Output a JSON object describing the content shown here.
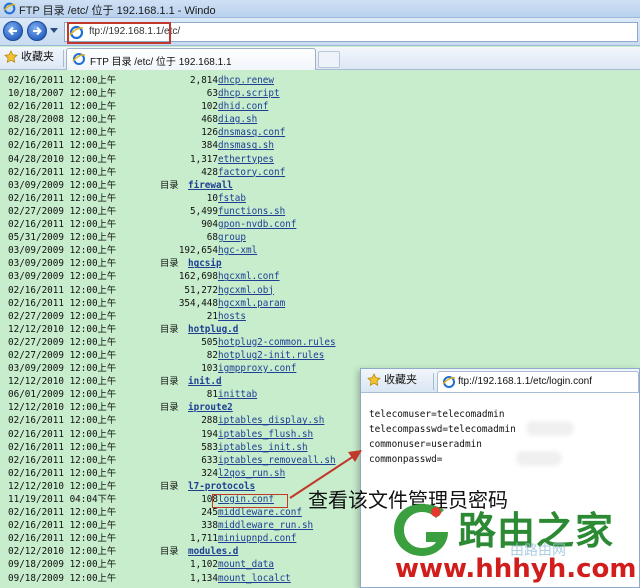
{
  "window": {
    "title": "FTP 目录 /etc/ 位于 192.168.1.1 - Windo"
  },
  "address_bar": {
    "url_host": "ftp://192.168.1.1",
    "url_path": "/etc/"
  },
  "favorites": {
    "label": "收藏夹"
  },
  "tab": {
    "label": "FTP 目录 /etc/ 位于 192.168.1.1"
  },
  "listing": [
    {
      "date": "02/16/2011 12:00上午",
      "size": "2,814",
      "name": "dhcp.renew"
    },
    {
      "date": "10/18/2007 12:00上午",
      "size": "63",
      "name": "dhcp.script"
    },
    {
      "date": "02/16/2011 12:00上午",
      "size": "102",
      "name": "dhid.conf"
    },
    {
      "date": "08/28/2008 12:00上午",
      "size": "468",
      "name": "diag.sh"
    },
    {
      "date": "02/16/2011 12:00上午",
      "size": "126",
      "name": "dnsmasq.conf"
    },
    {
      "date": "02/16/2011 12:00上午",
      "size": "384",
      "name": "dnsmasq.sh"
    },
    {
      "date": "04/28/2010 12:00上午",
      "size": "1,317",
      "name": "ethertypes"
    },
    {
      "date": "02/16/2011 12:00上午",
      "size": "428",
      "name": "factory.conf"
    },
    {
      "date": "03/09/2009 12:00上午",
      "dir": "目录",
      "name": "firewall"
    },
    {
      "date": "02/16/2011 12:00上午",
      "size": "10",
      "name": "fstab"
    },
    {
      "date": "02/27/2009 12:00上午",
      "size": "5,499",
      "name": "functions.sh"
    },
    {
      "date": "02/16/2011 12:00上午",
      "size": "904",
      "name": "gpon-nvdb.conf"
    },
    {
      "date": "05/31/2009 12:00上午",
      "size": "68",
      "name": "group"
    },
    {
      "date": "03/09/2009 12:00上午",
      "size": "192,654",
      "name": "hgc-xml"
    },
    {
      "date": "03/09/2009 12:00上午",
      "dir": "目录",
      "name": "hgcsip"
    },
    {
      "date": "03/09/2009 12:00上午",
      "size": "162,698",
      "name": "hgcxml.conf"
    },
    {
      "date": "02/16/2011 12:00上午",
      "size": "51,272",
      "name": "hgcxml.obj"
    },
    {
      "date": "02/16/2011 12:00上午",
      "size": "354,448",
      "name": "hgcxml.param"
    },
    {
      "date": "02/27/2009 12:00上午",
      "size": "21",
      "name": "hosts"
    },
    {
      "date": "12/12/2010 12:00上午",
      "dir": "目录",
      "name": "hotplug.d"
    },
    {
      "date": "02/27/2009 12:00上午",
      "size": "505",
      "name": "hotplug2-common.rules"
    },
    {
      "date": "02/27/2009 12:00上午",
      "size": "82",
      "name": "hotplug2-init.rules"
    },
    {
      "date": "03/09/2009 12:00上午",
      "size": "103",
      "name": "igmpproxy.conf"
    },
    {
      "date": "12/12/2010 12:00上午",
      "dir": "目录",
      "name": "init.d"
    },
    {
      "date": "06/01/2009 12:00上午",
      "size": "81",
      "name": "inittab"
    },
    {
      "date": "12/12/2010 12:00上午",
      "dir": "目录",
      "name": "iproute2"
    },
    {
      "date": "02/16/2011 12:00上午",
      "size": "288",
      "name": "iptables_display.sh"
    },
    {
      "date": "02/16/2011 12:00上午",
      "size": "194",
      "name": "iptables_flush.sh"
    },
    {
      "date": "02/16/2011 12:00上午",
      "size": "583",
      "name": "iptables_init.sh"
    },
    {
      "date": "02/16/2011 12:00上午",
      "size": "633",
      "name": "iptables_removeall.sh"
    },
    {
      "date": "02/16/2011 12:00上午",
      "size": "324",
      "name": "l2qos_run.sh"
    },
    {
      "date": "12/12/2010 12:00上午",
      "dir": "目录",
      "name": "l7-protocols"
    },
    {
      "date": "11/19/2011 04:04下午",
      "size": "108",
      "name": "login.conf"
    },
    {
      "date": "02/16/2011 12:00上午",
      "size": "245",
      "name": "middleware.conf"
    },
    {
      "date": "02/16/2011 12:00上午",
      "size": "338",
      "name": "middleware_run.sh"
    },
    {
      "date": "02/16/2011 12:00上午",
      "size": "1,711",
      "name": "miniupnpd.conf"
    },
    {
      "date": "02/12/2010 12:00上午",
      "dir": "目录",
      "name": "modules.d"
    },
    {
      "date": "09/18/2009 12:00上午",
      "size": "1,102",
      "name": "mount_data"
    },
    {
      "date": "09/18/2009 12:00上午",
      "size": "1,134",
      "name": "mount_localct"
    }
  ],
  "popup": {
    "favorites_label": "收藏夹",
    "tab_label": "ftp://192.168.1.1/etc/login.conf",
    "lines": [
      "telecomuser=telecomadmin",
      "telecompasswd=telecomadmin",
      "commonuser=useradmin",
      "commonpasswd="
    ]
  },
  "annotation": {
    "text": "查看该文件管理员密码"
  },
  "watermark": {
    "brand": "路由之家",
    "sub": "由路由网",
    "url": "www.hhhyh.com"
  },
  "colors": {
    "page_background": "#c7edcc",
    "link": "#1f3f94",
    "highlight": "#c0392b",
    "brand_green": "#2c8a35",
    "brand_red": "#d21d1d"
  }
}
